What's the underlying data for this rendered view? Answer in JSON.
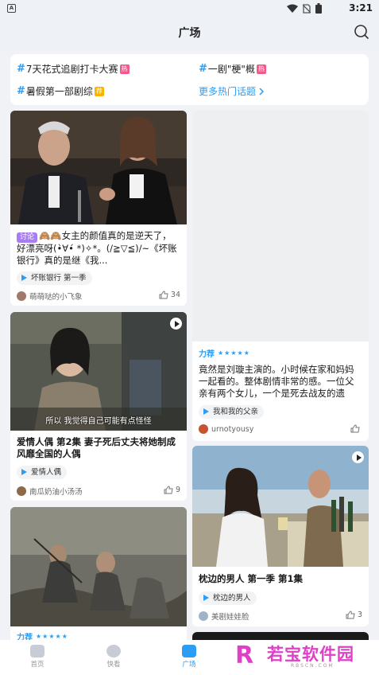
{
  "status": {
    "time": "3:21",
    "app_badge": "A"
  },
  "header": {
    "title": "广场"
  },
  "topics": [
    {
      "label": "7天花式追剧打卡大赛",
      "badge": "热"
    },
    {
      "label": "一剧\"梗\"概",
      "badge": "热"
    },
    {
      "label": "暑假第一部剧综",
      "badge": "荐"
    },
    {
      "label": "更多热门话题"
    }
  ],
  "cards": [
    {
      "tag": "讨论",
      "text": "🙈🙈女主的颜值真的是逆天了，好漂亮呀(•̀∀•́ *)✧*。(/≧▽≦)/~《坏账银行》真的是继《我...",
      "show": "坏账银行 第一季",
      "author": "萌萌哒的小飞象",
      "likes": "34"
    },
    {
      "rec": "力荐",
      "text": "竟然是刘璇主演的。小时候在家和妈妈一起看的。整体剧情非常的感。一位父亲有两个女儿，一个是死去战友的遗孤，一...",
      "show": "我和我的父亲",
      "author": "urnotyousy",
      "likes": ""
    },
    {
      "text": "爱情人偶 第2集 妻子死后丈夫将她制成风靡全国的人偶",
      "show": "爱情人偶",
      "author": "南瓜奶油小汤汤",
      "likes": "9",
      "subtitle": "所以 我觉得自己可能有点怪怪"
    },
    {
      "text": "枕边的男人 第一季 第1集",
      "show": "枕边的男人",
      "author": "美剧娃娃脸",
      "likes": "3"
    },
    {
      "rec": "力荐"
    }
  ],
  "nav": [
    {
      "label": "首页"
    },
    {
      "label": "快看"
    },
    {
      "label": "广场"
    }
  ],
  "watermark": {
    "text": "若宝软件园",
    "letter": "R",
    "url": "RBSCN.COM"
  },
  "colors": {
    "accent": "#2b9df5",
    "hot": "#f05a8a",
    "recommend": "#f7b500",
    "discuss": "#a87df2"
  }
}
